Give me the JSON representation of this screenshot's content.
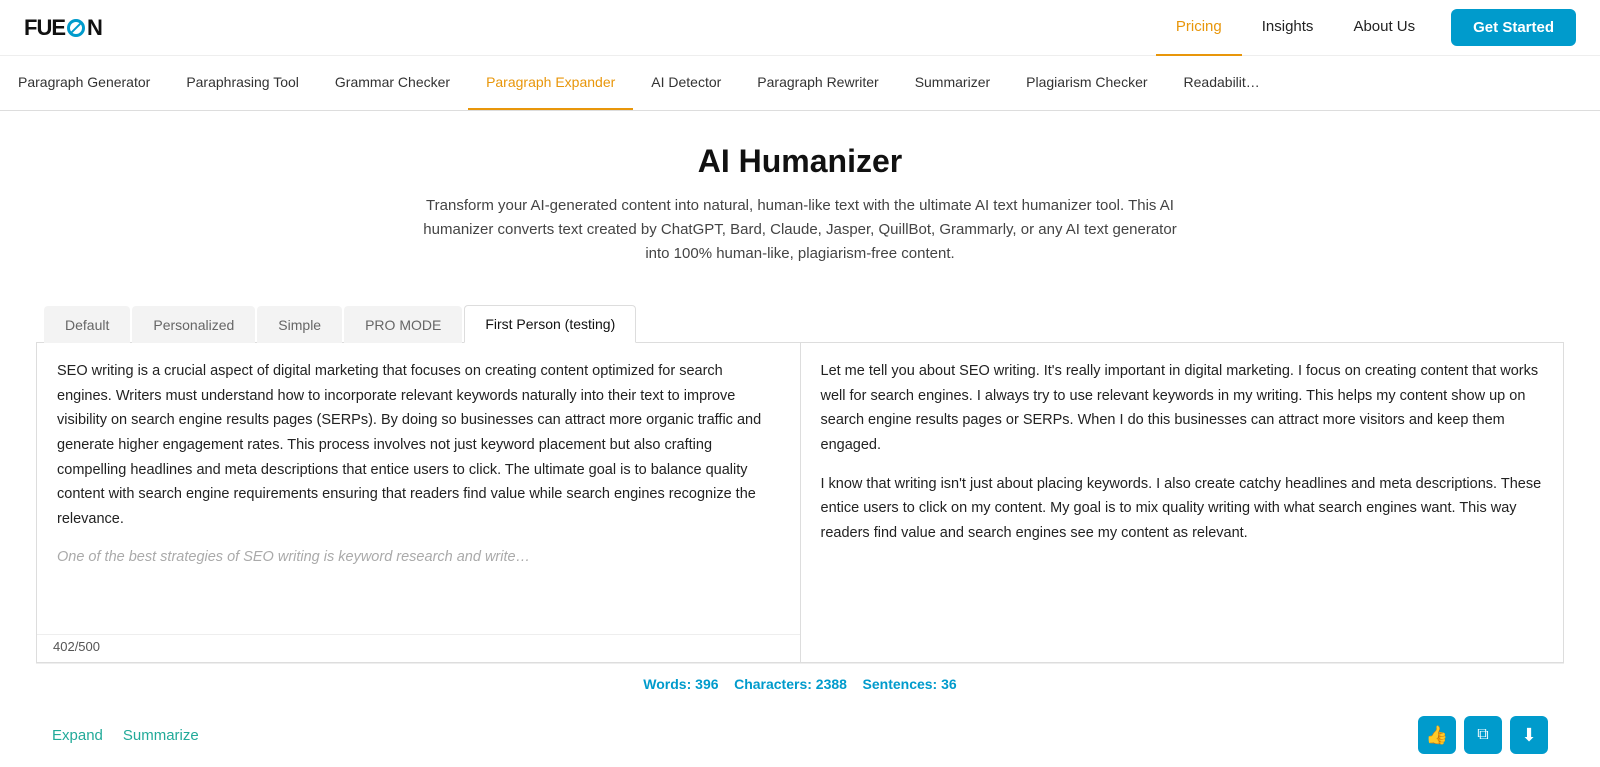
{
  "logo": {
    "text_before": "FUE",
    "text_after": "N"
  },
  "nav": {
    "links": [
      {
        "label": "Pricing",
        "active": true
      },
      {
        "label": "Insights",
        "active": false
      },
      {
        "label": "About Us",
        "active": false
      }
    ],
    "cta": "Get Started"
  },
  "tool_tabs": [
    {
      "label": "Paragraph Generator",
      "active": false
    },
    {
      "label": "Paraphrasing Tool",
      "active": false
    },
    {
      "label": "Grammar Checker",
      "active": false
    },
    {
      "label": "Paragraph Expander",
      "active": false
    },
    {
      "label": "AI Detector",
      "active": false
    },
    {
      "label": "Paragraph Rewriter",
      "active": false
    },
    {
      "label": "Summarizer",
      "active": false
    },
    {
      "label": "Plagiarism Checker",
      "active": false
    },
    {
      "label": "Readabilit…",
      "active": false
    }
  ],
  "hero": {
    "title": "AI Humanizer",
    "description": "Transform your AI-generated content into natural, human-like text with the ultimate AI text humanizer tool. This AI humanizer converts text created by ChatGPT, Bard, Claude, Jasper, QuillBot, Grammarly, or any AI text generator into 100% human-like, plagiarism-free content."
  },
  "mode_tabs": [
    {
      "label": "Default",
      "active": false
    },
    {
      "label": "Personalized",
      "active": false
    },
    {
      "label": "Simple",
      "active": false
    },
    {
      "label": "PRO MODE",
      "active": false
    },
    {
      "label": "First Person (testing)",
      "active": true
    }
  ],
  "input_pane": {
    "content_p1": "SEO writing is a crucial aspect of digital marketing that focuses on creating content optimized for search engines. Writers must understand how to incorporate relevant keywords naturally into their text to improve visibility on search engine results pages (SERPs). By doing so businesses can attract more organic traffic and generate higher engagement rates. This process involves not just keyword placement but also crafting compelling headlines and meta descriptions that entice users to click. The ultimate goal is to balance quality content with search engine requirements ensuring that readers find value while search engines recognize the relevance.",
    "content_partial": "One of the best strategies of SEO writing is keyword research and write…",
    "char_count": "402/500"
  },
  "output_pane": {
    "content_p1": "Let me tell you about SEO writing. It's really important in digital marketing. I focus on creating content that works well for search engines. I always try to use relevant keywords in my writing. This helps my content show up on search engine results pages or SERPs. When I do this businesses can attract more visitors and keep them engaged.",
    "content_p2": "I know that writing isn't just about placing keywords. I also create catchy headlines and meta descriptions. These entice users to click on my content. My goal is to mix quality writing with what search engines want. This way readers find value and search engines see my content as relevant."
  },
  "stats": {
    "words_label": "Words:",
    "words_value": "396",
    "chars_label": "Characters:",
    "chars_value": "2388",
    "sentences_label": "Sentences:",
    "sentences_value": "36"
  },
  "bottom_actions": {
    "expand": "Expand",
    "summarize": "Summarize"
  },
  "icons": {
    "thumbs_up": "👍",
    "copy": "⧉",
    "download": "⬇"
  }
}
